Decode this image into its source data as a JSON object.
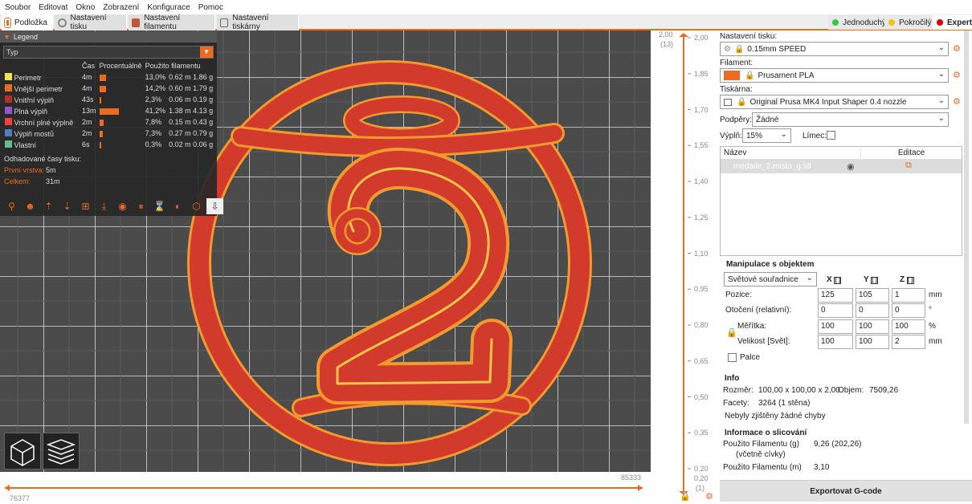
{
  "menu": [
    "Soubor",
    "Editovat",
    "Okno",
    "Zobrazení",
    "Konfigurace",
    "Pomoc"
  ],
  "tabs": [
    "Podložka",
    "Nastavení tisku",
    "Nastavení filamentu",
    "Nastavení tiskárny"
  ],
  "modes": [
    {
      "label": "Jednoduchý",
      "color": "#2ecc40"
    },
    {
      "label": "Pokročilý",
      "color": "#f1c40f"
    },
    {
      "label": "Expert",
      "color": "#e00000"
    }
  ],
  "legend": {
    "title": "Legend",
    "type_label": "Typ",
    "headers": [
      "Čas",
      "Procentuálně",
      "Použito filamentu"
    ],
    "rows": [
      {
        "name": "Perimetr",
        "color": "#f5e34f",
        "time": "4m",
        "pct": "13,0%",
        "pct_value": 13.0,
        "m": "0.62 m",
        "g": "1.86 g"
      },
      {
        "name": "Vnější perimetr",
        "color": "#ed6b21",
        "time": "4m",
        "pct": "14,2%",
        "pct_value": 14.2,
        "m": "0.60 m",
        "g": "1.79 g"
      },
      {
        "name": "Vnitřní výplň",
        "color": "#b03029",
        "time": "43s",
        "pct": "2,3%",
        "pct_value": 2.3,
        "m": "0.06 m",
        "g": "0.19 g"
      },
      {
        "name": "Plná výplň",
        "color": "#9654cc",
        "time": "13m",
        "pct": "41,2%",
        "pct_value": 41.2,
        "m": "1.38 m",
        "g": "4.13 g"
      },
      {
        "name": "Vrchní plné výplně",
        "color": "#f04040",
        "time": "2m",
        "pct": "7,8%",
        "pct_value": 7.8,
        "m": "0.15 m",
        "g": "0.43 g"
      },
      {
        "name": "Výplň mostů",
        "color": "#4d80ba",
        "time": "2m",
        "pct": "7,3%",
        "pct_value": 7.3,
        "m": "0.27 m",
        "g": "0.79 g"
      },
      {
        "name": "Vlastní",
        "color": "#5ebd8a",
        "time": "6s",
        "pct": "0,3%",
        "pct_value": 0.3,
        "m": "0.02 m",
        "g": "0.06 g"
      }
    ],
    "est_label": "Odhadované časy tisku:",
    "first_layer_label": "První vrstva:",
    "first_layer_value": "5m",
    "total_label": "Celkem:",
    "total_value": "31m"
  },
  "vslider": {
    "top_value": "2,00",
    "top_layer": "(13)",
    "bottom_value": "0,20",
    "bottom_layer": "(1)",
    "ticks": [
      "2,00",
      "1,85",
      "1,70",
      "1,55",
      "1,40",
      "1,25",
      "1,10",
      "0,95",
      "0,80",
      "0,65",
      "0,50",
      "0,35",
      "0,20"
    ]
  },
  "hslider": {
    "right_value": "85333",
    "left_value": "76377"
  },
  "panel": {
    "print_label": "Nastavení tisku:",
    "print_value": "0.15mm SPEED",
    "filament_label": "Filament:",
    "filament_value": "Prusament PLA",
    "filament_color": "#ed6b21",
    "printer_label": "Tiskárna:",
    "printer_value": "Original Prusa MK4 Input Shaper 0.4 nozzle",
    "supports_label": "Podpěry:",
    "supports_value": "Žádné",
    "infill_label": "Výplň:",
    "infill_value": "15%",
    "brim_label": "Límec:",
    "list_name_header": "Název",
    "list_edit_header": "Editace",
    "object_name": "medaile_2.misto_g.stl",
    "manip_title": "Manipulace s objektem",
    "coord_value": "Světové souřadnice",
    "axis_x": "X",
    "axis_y": "Y",
    "axis_z": "Z",
    "position_label": "Pozice:",
    "position": [
      "125",
      "105",
      "1"
    ],
    "rotation_label": "Otočení (relativní):",
    "rotation": [
      "0",
      "0",
      "0"
    ],
    "scale_label": "Měřítka:",
    "scale": [
      "100",
      "100",
      "100"
    ],
    "size_label": "Velikost [Svět]:",
    "size": [
      "100",
      "100",
      "2"
    ],
    "unit_mm": "mm",
    "unit_deg": "°",
    "unit_pct": "%",
    "inches_label": "Palce",
    "info_title": "Info",
    "size_info_label": "Rozměr:",
    "size_info_value": "100,00 x 100,00 x 2,00",
    "volume_label": "Objem:",
    "volume_value": "7509,26",
    "facets_label": "Facety:",
    "facets_value": "3264 (1 stěna)",
    "errors_text": "Nebyly zjištěny žádné chyby",
    "slice_title": "Informace o slicování",
    "used_g_label": "Použito Filamentu (g)",
    "used_g_sub": "(včetně cívky)",
    "used_g_value": "9,26 (202,26)",
    "used_m_label": "Použito Filamentu (m)",
    "used_m_value": "3,10",
    "export_label": "Exportovat G-code"
  }
}
